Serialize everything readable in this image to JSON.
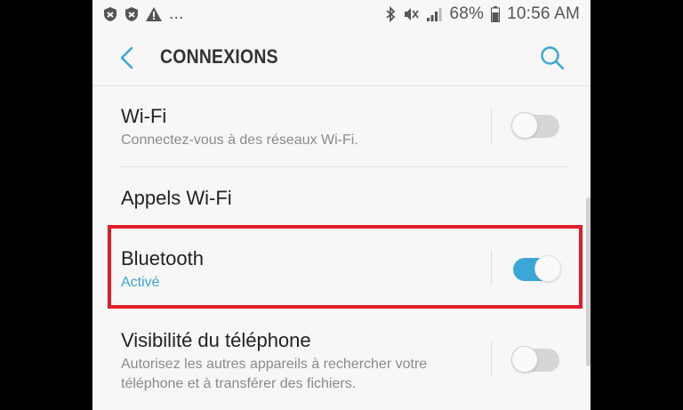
{
  "status_bar": {
    "battery": "68%",
    "time": "10:56 AM",
    "more": "..."
  },
  "app_bar": {
    "title": "CONNEXIONS",
    "back_icon": "chevron-left-icon",
    "search_icon": "search-icon"
  },
  "settings": [
    {
      "label": "Wi-Fi",
      "subtitle": "Connectez-vous à des réseaux Wi-Fi.",
      "toggle": "off"
    },
    {
      "label": "Appels Wi-Fi"
    },
    {
      "label": "Bluetooth",
      "subtitle": "Activé",
      "toggle": "on"
    },
    {
      "label": "Visibilité du téléphone",
      "subtitle_line1": "Autorisez les autres appareils à rechercher votre",
      "subtitle_line2": "téléphone et à transférer des fichiers.",
      "toggle": "off"
    }
  ],
  "colors": {
    "accent": "#3aa7d6",
    "highlight": "#e01e2a",
    "background": "#f7f7f7"
  }
}
